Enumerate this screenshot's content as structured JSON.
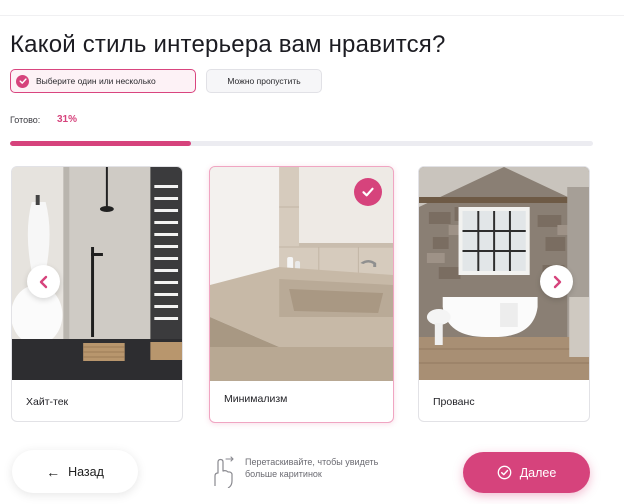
{
  "title": "Какой стиль интерьера вам нравится?",
  "chips": {
    "select": "Выберите один или несколько",
    "skip": "Можно пропустить"
  },
  "progress": {
    "label": "Готово:",
    "value_text": "31%",
    "value": 0.31
  },
  "styles": [
    {
      "label": "Хайт-тек",
      "selected": false
    },
    {
      "label": "Минимализм",
      "selected": true
    },
    {
      "label": "Прованс",
      "selected": false
    }
  ],
  "nav": {
    "back_label": "Назад",
    "next_label": "Далее",
    "hint": "Перетаскивайте, чтобы увидеть больше каритинок"
  },
  "colors": {
    "accent": "#d6437c",
    "track": "#ececf1"
  },
  "icons": {
    "check": "check-icon",
    "prev": "chevron-left-icon",
    "next": "chevron-right-icon",
    "drag": "hand-swipe-icon"
  }
}
